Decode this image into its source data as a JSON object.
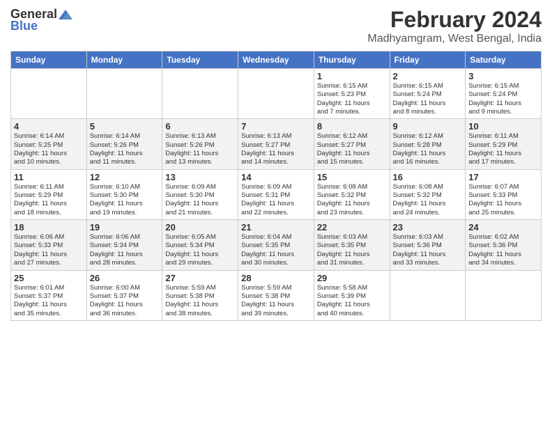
{
  "header": {
    "logo": {
      "general": "General",
      "blue": "Blue"
    },
    "title": "February 2024",
    "location": "Madhyamgram, West Bengal, India"
  },
  "weekdays": [
    "Sunday",
    "Monday",
    "Tuesday",
    "Wednesday",
    "Thursday",
    "Friday",
    "Saturday"
  ],
  "weeks": [
    [
      {
        "day": "",
        "info": ""
      },
      {
        "day": "",
        "info": ""
      },
      {
        "day": "",
        "info": ""
      },
      {
        "day": "",
        "info": ""
      },
      {
        "day": "1",
        "info": "Sunrise: 6:15 AM\nSunset: 5:23 PM\nDaylight: 11 hours\nand 7 minutes."
      },
      {
        "day": "2",
        "info": "Sunrise: 6:15 AM\nSunset: 5:24 PM\nDaylight: 11 hours\nand 8 minutes."
      },
      {
        "day": "3",
        "info": "Sunrise: 6:15 AM\nSunset: 5:24 PM\nDaylight: 11 hours\nand 9 minutes."
      }
    ],
    [
      {
        "day": "4",
        "info": "Sunrise: 6:14 AM\nSunset: 5:25 PM\nDaylight: 11 hours\nand 10 minutes."
      },
      {
        "day": "5",
        "info": "Sunrise: 6:14 AM\nSunset: 5:26 PM\nDaylight: 11 hours\nand 11 minutes."
      },
      {
        "day": "6",
        "info": "Sunrise: 6:13 AM\nSunset: 5:26 PM\nDaylight: 11 hours\nand 13 minutes."
      },
      {
        "day": "7",
        "info": "Sunrise: 6:13 AM\nSunset: 5:27 PM\nDaylight: 11 hours\nand 14 minutes."
      },
      {
        "day": "8",
        "info": "Sunrise: 6:12 AM\nSunset: 5:27 PM\nDaylight: 11 hours\nand 15 minutes."
      },
      {
        "day": "9",
        "info": "Sunrise: 6:12 AM\nSunset: 5:28 PM\nDaylight: 11 hours\nand 16 minutes."
      },
      {
        "day": "10",
        "info": "Sunrise: 6:11 AM\nSunset: 5:29 PM\nDaylight: 11 hours\nand 17 minutes."
      }
    ],
    [
      {
        "day": "11",
        "info": "Sunrise: 6:11 AM\nSunset: 5:29 PM\nDaylight: 11 hours\nand 18 minutes."
      },
      {
        "day": "12",
        "info": "Sunrise: 6:10 AM\nSunset: 5:30 PM\nDaylight: 11 hours\nand 19 minutes."
      },
      {
        "day": "13",
        "info": "Sunrise: 6:09 AM\nSunset: 5:30 PM\nDaylight: 11 hours\nand 21 minutes."
      },
      {
        "day": "14",
        "info": "Sunrise: 6:09 AM\nSunset: 5:31 PM\nDaylight: 11 hours\nand 22 minutes."
      },
      {
        "day": "15",
        "info": "Sunrise: 6:08 AM\nSunset: 5:32 PM\nDaylight: 11 hours\nand 23 minutes."
      },
      {
        "day": "16",
        "info": "Sunrise: 6:08 AM\nSunset: 5:32 PM\nDaylight: 11 hours\nand 24 minutes."
      },
      {
        "day": "17",
        "info": "Sunrise: 6:07 AM\nSunset: 5:33 PM\nDaylight: 11 hours\nand 25 minutes."
      }
    ],
    [
      {
        "day": "18",
        "info": "Sunrise: 6:06 AM\nSunset: 5:33 PM\nDaylight: 11 hours\nand 27 minutes."
      },
      {
        "day": "19",
        "info": "Sunrise: 6:06 AM\nSunset: 5:34 PM\nDaylight: 11 hours\nand 28 minutes."
      },
      {
        "day": "20",
        "info": "Sunrise: 6:05 AM\nSunset: 5:34 PM\nDaylight: 11 hours\nand 29 minutes."
      },
      {
        "day": "21",
        "info": "Sunrise: 6:04 AM\nSunset: 5:35 PM\nDaylight: 11 hours\nand 30 minutes."
      },
      {
        "day": "22",
        "info": "Sunrise: 6:03 AM\nSunset: 5:35 PM\nDaylight: 11 hours\nand 31 minutes."
      },
      {
        "day": "23",
        "info": "Sunrise: 6:03 AM\nSunset: 5:36 PM\nDaylight: 11 hours\nand 33 minutes."
      },
      {
        "day": "24",
        "info": "Sunrise: 6:02 AM\nSunset: 5:36 PM\nDaylight: 11 hours\nand 34 minutes."
      }
    ],
    [
      {
        "day": "25",
        "info": "Sunrise: 6:01 AM\nSunset: 5:37 PM\nDaylight: 11 hours\nand 35 minutes."
      },
      {
        "day": "26",
        "info": "Sunrise: 6:00 AM\nSunset: 5:37 PM\nDaylight: 11 hours\nand 36 minutes."
      },
      {
        "day": "27",
        "info": "Sunrise: 5:59 AM\nSunset: 5:38 PM\nDaylight: 11 hours\nand 38 minutes."
      },
      {
        "day": "28",
        "info": "Sunrise: 5:59 AM\nSunset: 5:38 PM\nDaylight: 11 hours\nand 39 minutes."
      },
      {
        "day": "29",
        "info": "Sunrise: 5:58 AM\nSunset: 5:39 PM\nDaylight: 11 hours\nand 40 minutes."
      },
      {
        "day": "",
        "info": ""
      },
      {
        "day": "",
        "info": ""
      }
    ]
  ]
}
